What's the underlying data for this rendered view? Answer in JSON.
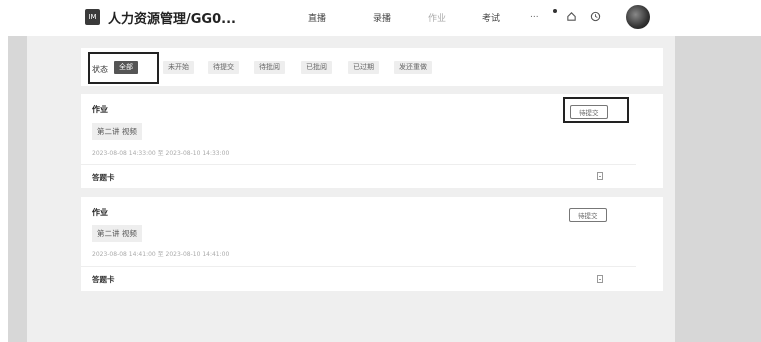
{
  "header": {
    "logo_text": "IM",
    "app_title": "人力资源管理/GG0...",
    "nav": [
      {
        "label": "直播"
      },
      {
        "label": "录播"
      },
      {
        "label": "作业"
      },
      {
        "label": "考试"
      }
    ],
    "more_label": "..."
  },
  "filter": {
    "label": "状态",
    "options": [
      {
        "label": "全部"
      },
      {
        "label": "未开始"
      },
      {
        "label": "待提交"
      },
      {
        "label": "待批阅"
      },
      {
        "label": "已批阅"
      },
      {
        "label": "已过期"
      },
      {
        "label": "发还重做"
      }
    ]
  },
  "homeworks": [
    {
      "title": "作业",
      "lesson": "第二讲 视频",
      "time_range": "2023-08-08 14:33:00 至 2023-08-10 14:33:00",
      "sheet_label": "答题卡",
      "action_label": "待提交"
    },
    {
      "title": "作业",
      "lesson": "第二讲 视频",
      "time_range": "2023-08-08 14:41:00 至 2023-08-10 14:41:00",
      "sheet_label": "答题卡",
      "action_label": "待提交"
    }
  ]
}
